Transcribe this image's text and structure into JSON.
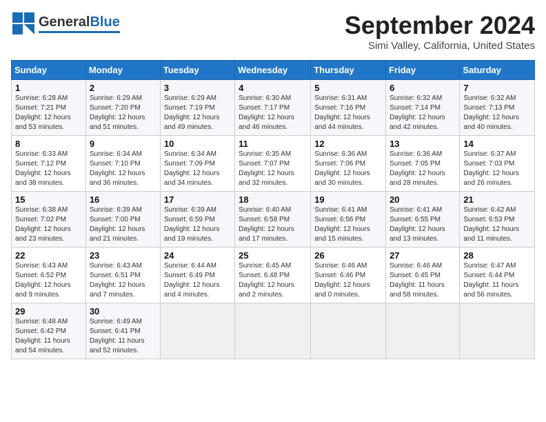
{
  "header": {
    "logo_general": "General",
    "logo_blue": "Blue",
    "title": "September 2024",
    "subtitle": "Simi Valley, California, United States"
  },
  "days_of_week": [
    "Sunday",
    "Monday",
    "Tuesday",
    "Wednesday",
    "Thursday",
    "Friday",
    "Saturday"
  ],
  "weeks": [
    [
      {
        "day": "1",
        "sunrise": "Sunrise: 6:28 AM",
        "sunset": "Sunset: 7:21 PM",
        "daylight": "Daylight: 12 hours and 53 minutes."
      },
      {
        "day": "2",
        "sunrise": "Sunrise: 6:29 AM",
        "sunset": "Sunset: 7:20 PM",
        "daylight": "Daylight: 12 hours and 51 minutes."
      },
      {
        "day": "3",
        "sunrise": "Sunrise: 6:29 AM",
        "sunset": "Sunset: 7:19 PM",
        "daylight": "Daylight: 12 hours and 49 minutes."
      },
      {
        "day": "4",
        "sunrise": "Sunrise: 6:30 AM",
        "sunset": "Sunset: 7:17 PM",
        "daylight": "Daylight: 12 hours and 46 minutes."
      },
      {
        "day": "5",
        "sunrise": "Sunrise: 6:31 AM",
        "sunset": "Sunset: 7:16 PM",
        "daylight": "Daylight: 12 hours and 44 minutes."
      },
      {
        "day": "6",
        "sunrise": "Sunrise: 6:32 AM",
        "sunset": "Sunset: 7:14 PM",
        "daylight": "Daylight: 12 hours and 42 minutes."
      },
      {
        "day": "7",
        "sunrise": "Sunrise: 6:32 AM",
        "sunset": "Sunset: 7:13 PM",
        "daylight": "Daylight: 12 hours and 40 minutes."
      }
    ],
    [
      {
        "day": "8",
        "sunrise": "Sunrise: 6:33 AM",
        "sunset": "Sunset: 7:12 PM",
        "daylight": "Daylight: 12 hours and 38 minutes."
      },
      {
        "day": "9",
        "sunrise": "Sunrise: 6:34 AM",
        "sunset": "Sunset: 7:10 PM",
        "daylight": "Daylight: 12 hours and 36 minutes."
      },
      {
        "day": "10",
        "sunrise": "Sunrise: 6:34 AM",
        "sunset": "Sunset: 7:09 PM",
        "daylight": "Daylight: 12 hours and 34 minutes."
      },
      {
        "day": "11",
        "sunrise": "Sunrise: 6:35 AM",
        "sunset": "Sunset: 7:07 PM",
        "daylight": "Daylight: 12 hours and 32 minutes."
      },
      {
        "day": "12",
        "sunrise": "Sunrise: 6:36 AM",
        "sunset": "Sunset: 7:06 PM",
        "daylight": "Daylight: 12 hours and 30 minutes."
      },
      {
        "day": "13",
        "sunrise": "Sunrise: 6:36 AM",
        "sunset": "Sunset: 7:05 PM",
        "daylight": "Daylight: 12 hours and 28 minutes."
      },
      {
        "day": "14",
        "sunrise": "Sunrise: 6:37 AM",
        "sunset": "Sunset: 7:03 PM",
        "daylight": "Daylight: 12 hours and 26 minutes."
      }
    ],
    [
      {
        "day": "15",
        "sunrise": "Sunrise: 6:38 AM",
        "sunset": "Sunset: 7:02 PM",
        "daylight": "Daylight: 12 hours and 23 minutes."
      },
      {
        "day": "16",
        "sunrise": "Sunrise: 6:39 AM",
        "sunset": "Sunset: 7:00 PM",
        "daylight": "Daylight: 12 hours and 21 minutes."
      },
      {
        "day": "17",
        "sunrise": "Sunrise: 6:39 AM",
        "sunset": "Sunset: 6:59 PM",
        "daylight": "Daylight: 12 hours and 19 minutes."
      },
      {
        "day": "18",
        "sunrise": "Sunrise: 6:40 AM",
        "sunset": "Sunset: 6:58 PM",
        "daylight": "Daylight: 12 hours and 17 minutes."
      },
      {
        "day": "19",
        "sunrise": "Sunrise: 6:41 AM",
        "sunset": "Sunset: 6:56 PM",
        "daylight": "Daylight: 12 hours and 15 minutes."
      },
      {
        "day": "20",
        "sunrise": "Sunrise: 6:41 AM",
        "sunset": "Sunset: 6:55 PM",
        "daylight": "Daylight: 12 hours and 13 minutes."
      },
      {
        "day": "21",
        "sunrise": "Sunrise: 6:42 AM",
        "sunset": "Sunset: 6:53 PM",
        "daylight": "Daylight: 12 hours and 11 minutes."
      }
    ],
    [
      {
        "day": "22",
        "sunrise": "Sunrise: 6:43 AM",
        "sunset": "Sunset: 6:52 PM",
        "daylight": "Daylight: 12 hours and 9 minutes."
      },
      {
        "day": "23",
        "sunrise": "Sunrise: 6:43 AM",
        "sunset": "Sunset: 6:51 PM",
        "daylight": "Daylight: 12 hours and 7 minutes."
      },
      {
        "day": "24",
        "sunrise": "Sunrise: 6:44 AM",
        "sunset": "Sunset: 6:49 PM",
        "daylight": "Daylight: 12 hours and 4 minutes."
      },
      {
        "day": "25",
        "sunrise": "Sunrise: 6:45 AM",
        "sunset": "Sunset: 6:48 PM",
        "daylight": "Daylight: 12 hours and 2 minutes."
      },
      {
        "day": "26",
        "sunrise": "Sunrise: 6:46 AM",
        "sunset": "Sunset: 6:46 PM",
        "daylight": "Daylight: 12 hours and 0 minutes."
      },
      {
        "day": "27",
        "sunrise": "Sunrise: 6:46 AM",
        "sunset": "Sunset: 6:45 PM",
        "daylight": "Daylight: 11 hours and 58 minutes."
      },
      {
        "day": "28",
        "sunrise": "Sunrise: 6:47 AM",
        "sunset": "Sunset: 6:44 PM",
        "daylight": "Daylight: 11 hours and 56 minutes."
      }
    ],
    [
      {
        "day": "29",
        "sunrise": "Sunrise: 6:48 AM",
        "sunset": "Sunset: 6:42 PM",
        "daylight": "Daylight: 11 hours and 54 minutes."
      },
      {
        "day": "30",
        "sunrise": "Sunrise: 6:49 AM",
        "sunset": "Sunset: 6:41 PM",
        "daylight": "Daylight: 11 hours and 52 minutes."
      },
      null,
      null,
      null,
      null,
      null
    ]
  ]
}
